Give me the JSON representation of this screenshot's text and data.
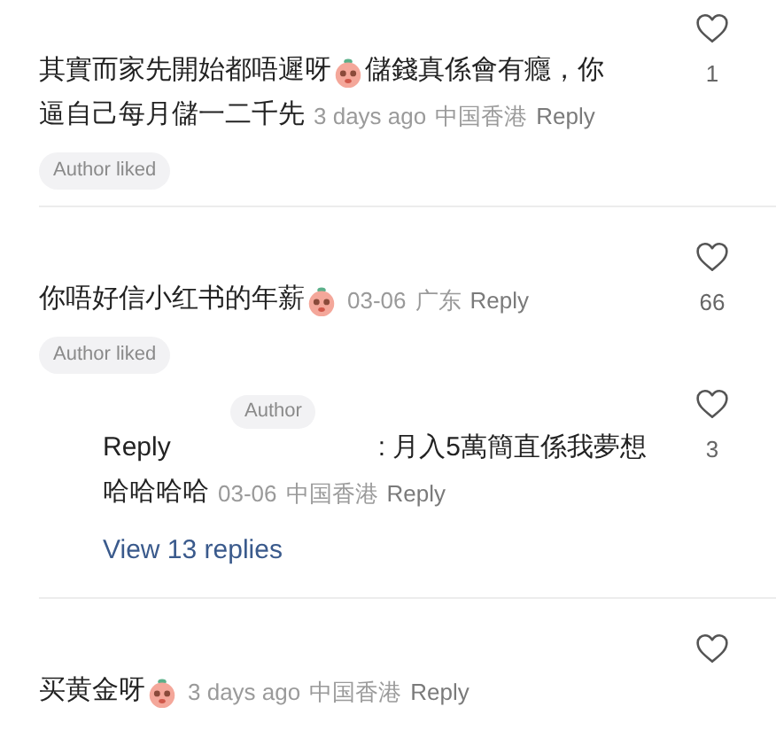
{
  "comments": [
    {
      "lines": [
        [
          {
            "kind": "text",
            "text": "其實而家先開始都唔遲呀"
          },
          {
            "kind": "sticker"
          },
          {
            "kind": "text",
            "text": "儲錢真係會有癮，你"
          }
        ],
        [
          {
            "kind": "text",
            "text": "逼自己每月儲一二千先"
          }
        ]
      ],
      "time": "3 days ago",
      "location": "中国香港",
      "reply": "Reply",
      "likes": "1",
      "badge": "Author liked"
    },
    {
      "lines": [
        [
          {
            "kind": "text",
            "text": "你唔好信小红书的年薪"
          },
          {
            "kind": "sticker"
          }
        ]
      ],
      "time": "03-06",
      "location": "广东",
      "reply": "Reply",
      "likes": "66",
      "badge": "Author liked",
      "sub_reply": {
        "author_badge": "Author",
        "prefix": "Reply",
        "text_lines": [
          ": 月入5萬簡直係我夢想",
          "哈哈哈哈"
        ],
        "time": "03-06",
        "location": "中国香港",
        "reply": "Reply",
        "likes": "3"
      },
      "view_replies": "View 13 replies"
    },
    {
      "lines": [
        [
          {
            "kind": "text",
            "text": "买黄金呀"
          },
          {
            "kind": "sticker"
          }
        ]
      ],
      "time": "3 days ago",
      "location": "中国香港",
      "reply": "Reply"
    }
  ]
}
